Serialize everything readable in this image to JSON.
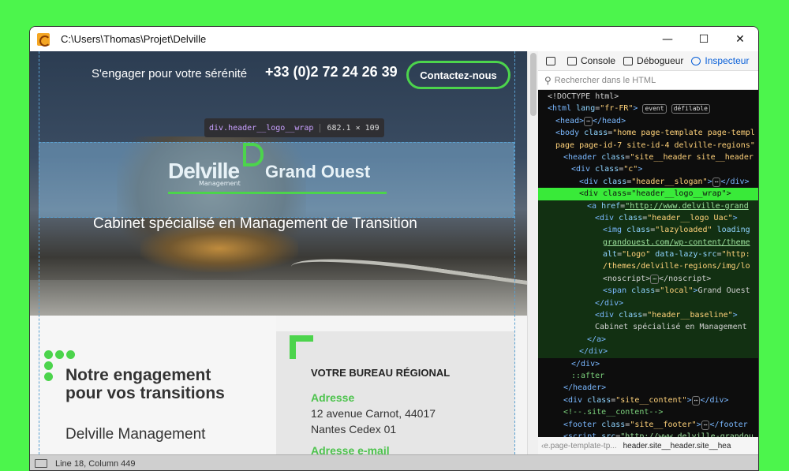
{
  "window": {
    "title": "C:\\Users\\Thomas\\Projet\\Delville",
    "controls": {
      "minimize": "—",
      "maximize": "☐",
      "close": "✕"
    }
  },
  "page": {
    "slogan": "S'engager pour votre sérénité",
    "phone": "+33 (0)2 72 24 26 39",
    "contact_button": "Contactez-nous",
    "tooltip": {
      "selector": "div.header__logo__wrap",
      "size": "682.1 × 109"
    },
    "logo": {
      "brand": "Delville",
      "sub": "Management",
      "region": "Grand Ouest"
    },
    "baseline": "Cabinet spécialisé en Management de Transition",
    "engagement_title_1": "Notre engagement",
    "engagement_title_2": "pour vos transitions",
    "company": "Delville Management",
    "bureau_title": "VOTRE BUREAU RÉGIONAL",
    "address_label": "Adresse",
    "address_line1": "12 avenue Carnot, 44017",
    "address_line2": "Nantes Cedex 01",
    "email_label": "Adresse e-mail"
  },
  "devtools": {
    "tabs": [
      "Console",
      "Débogueur",
      "Inspecteur"
    ],
    "search_placeholder": "Rechercher dans le HTML",
    "breadcrumb_prev": "‹e.page-template-tp...",
    "breadcrumb_current": "header.site__header.site__hea",
    "badges": {
      "event": "event",
      "flex": "défilable"
    }
  },
  "status": {
    "position": "Line 18, Column 449"
  },
  "colors": {
    "accent": "#4cd44c",
    "background": "#4cf54c",
    "selection": "#39ea39"
  }
}
